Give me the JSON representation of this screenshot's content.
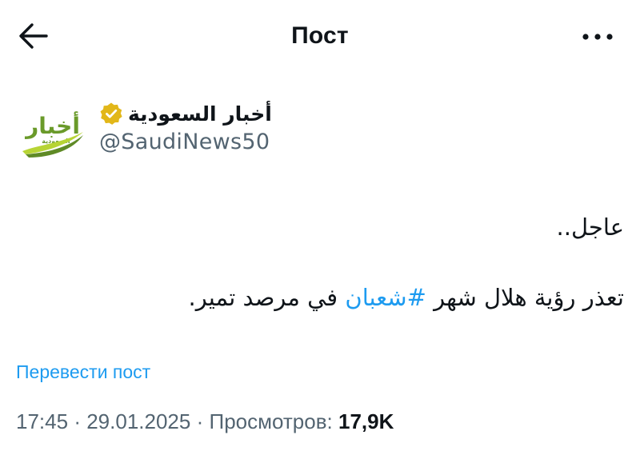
{
  "header": {
    "title": "Пост",
    "back_icon": "arrow-left-icon",
    "more_icon": "ellipsis-horizontal-icon"
  },
  "author": {
    "name": "أخبار السعودية",
    "handle": "@SaudiNews50",
    "verified": true,
    "badge_color": "#e2b719",
    "avatar_logo_text": "أخبار",
    "avatar_logo_subtext": "السعودية",
    "avatar_colors": {
      "text": "#6a9a2a",
      "swoosh_light": "#b7d435",
      "swoosh_dark": "#5f8a26"
    }
  },
  "tweet": {
    "line1": "عاجل..",
    "line2_part1": "تعذر رؤية هلال شهر",
    "hashtag": "#شعبان",
    "line2_part2": "في مرصد تمير."
  },
  "translate_label": "Перевести пост",
  "meta": {
    "time": "17:45",
    "separator": "·",
    "date": "29.01.2025",
    "views_label": "Просмотров:",
    "views_count": "17,9K"
  },
  "colors": {
    "link": "#1d9bf0",
    "secondary_text": "#536471",
    "primary_text": "#0f1419"
  }
}
